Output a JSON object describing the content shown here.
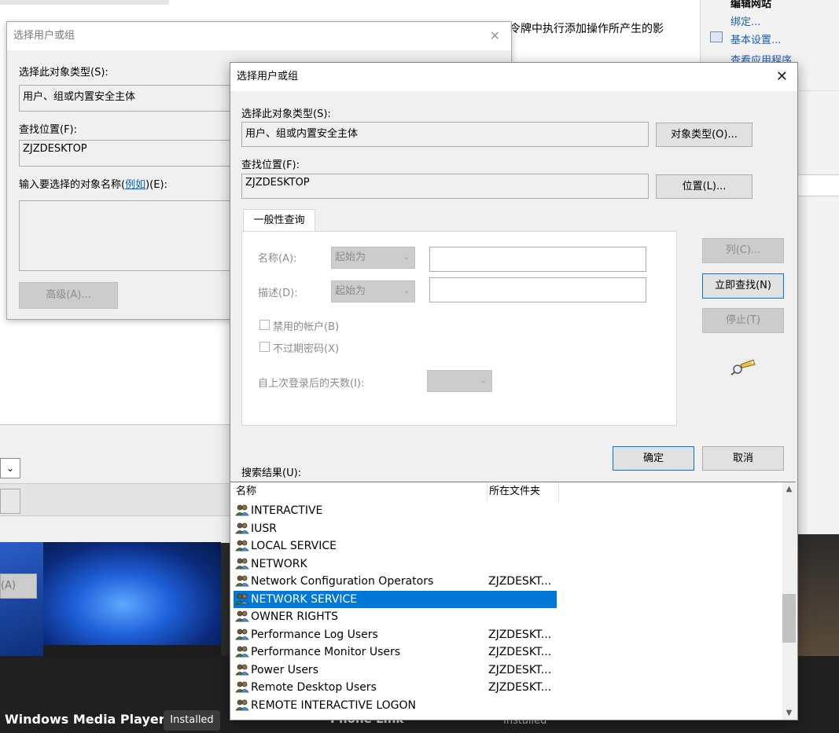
{
  "background": {
    "top_text": "令牌中执行添加操作所产生的影",
    "right_panel": {
      "title": "编辑网站",
      "bind": "绑定...",
      "basic_settings": "基本设置...",
      "view_apps": "查看应用程序"
    },
    "left_button": "(A)",
    "taskbar_app": "Windows Media Player",
    "installed": "Installed",
    "phone_link": "Phone Link",
    "installed2": "Installed"
  },
  "back_dialog": {
    "title": "选择用户或组",
    "object_type_label": "选择此对象类型(S):",
    "object_type_value": "用户、组或内置安全主体",
    "location_label": "查找位置(F):",
    "location_value": "ZJZDESKTOP",
    "enter_names_label_pre": "输入要选择的对象名称(",
    "enter_names_link": "例如",
    "enter_names_label_post": ")(E):",
    "advanced_button": "高级(A)..."
  },
  "dialog": {
    "title": "选择用户或组",
    "object_type_label": "选择此对象类型(S):",
    "object_type_value": "用户、组或内置安全主体",
    "object_type_button": "对象类型(O)...",
    "location_label": "查找位置(F):",
    "location_value": "ZJZDESKTOP",
    "location_button": "位置(L)...",
    "tab_general": "一般性查询",
    "name_label": "名称(A):",
    "name_combo": "起始为",
    "desc_label": "描述(D):",
    "desc_combo": "起始为",
    "disabled_accounts": "禁用的帐户(B)",
    "non_expiring_pw": "不过期密码(X)",
    "days_since_logon": "自上次登录后的天数(I):",
    "columns_button": "列(C)...",
    "find_now_button": "立即查找(N)",
    "stop_button": "停止(T)",
    "ok_button": "确定",
    "cancel_button": "取消",
    "results_label": "搜索结果(U):",
    "col_name": "名称",
    "col_folder": "所在文件夹",
    "results": [
      {
        "name": "INTERACTIVE",
        "folder": "",
        "selected": false
      },
      {
        "name": "IUSR",
        "folder": "",
        "selected": false
      },
      {
        "name": "LOCAL SERVICE",
        "folder": "",
        "selected": false
      },
      {
        "name": "NETWORK",
        "folder": "",
        "selected": false
      },
      {
        "name": "Network Configuration Operators",
        "folder": "ZJZDESKT...",
        "selected": false
      },
      {
        "name": "NETWORK SERVICE",
        "folder": "",
        "selected": true
      },
      {
        "name": "OWNER RIGHTS",
        "folder": "",
        "selected": false
      },
      {
        "name": "Performance Log Users",
        "folder": "ZJZDESKT...",
        "selected": false
      },
      {
        "name": "Performance Monitor Users",
        "folder": "ZJZDESKT...",
        "selected": false
      },
      {
        "name": "Power Users",
        "folder": "ZJZDESKT...",
        "selected": false
      },
      {
        "name": "Remote Desktop Users",
        "folder": "ZJZDESKT...",
        "selected": false
      },
      {
        "name": "REMOTE INTERACTIVE LOGON",
        "folder": "",
        "selected": false
      }
    ]
  }
}
